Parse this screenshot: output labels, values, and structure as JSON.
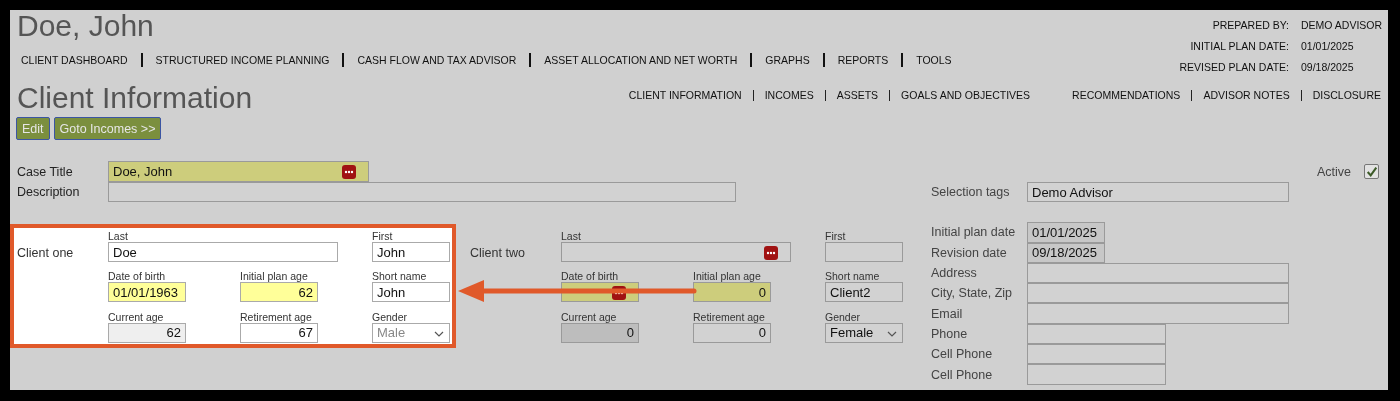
{
  "header": {
    "title": "Doe, John",
    "nav": [
      "CLIENT DASHBOARD",
      "STRUCTURED INCOME PLANNING",
      "CASH FLOW AND TAX ADVISOR",
      "ASSET ALLOCATION AND NET WORTH",
      "GRAPHS",
      "REPORTS",
      "TOOLS"
    ],
    "info": [
      {
        "label": "PREPARED BY:",
        "value": "DEMO ADVISOR"
      },
      {
        "label": "INITIAL PLAN DATE:",
        "value": "01/01/2025"
      },
      {
        "label": "REVISED PLAN DATE:",
        "value": "09/18/2025"
      }
    ]
  },
  "page": {
    "title": "Client Information",
    "subnav_left": [
      "CLIENT INFORMATION",
      "INCOMES",
      "ASSETS",
      "GOALS AND OBJECTIVES"
    ],
    "subnav_right": [
      "RECOMMENDATIONS",
      "ADVISOR NOTES",
      "DISCLOSURE"
    ]
  },
  "buttons": [
    "Edit",
    "Goto Incomes >>"
  ],
  "case_title": {
    "label": "Case Title",
    "value": "Doe, John",
    "required": true,
    "picker": true
  },
  "active": {
    "label": "Active",
    "checked": true
  },
  "description": {
    "label": "Description"
  },
  "selection_tags": {
    "label": "Selection tags",
    "value": "Demo Advisor"
  },
  "clients": [
    {
      "label": "Client one",
      "highlighted": true,
      "fields": [
        {
          "label": "Last",
          "value": "Doe",
          "kind": "text",
          "required": false,
          "readonly": false,
          "picker": false
        },
        {
          "label": "First",
          "value": "John",
          "kind": "text",
          "required": false,
          "readonly": false,
          "picker": false
        },
        {
          "label": "Date of birth",
          "value": "01/01/1963",
          "kind": "text",
          "required": true,
          "readonly": false,
          "picker": false
        },
        {
          "label": "Initial plan age",
          "value": "62",
          "kind": "number",
          "required": true,
          "readonly": false,
          "picker": false
        },
        {
          "label": "Short name",
          "value": "John",
          "kind": "text",
          "required": false,
          "readonly": false,
          "picker": false
        },
        {
          "label": "Current age",
          "value": "62",
          "kind": "number",
          "required": false,
          "readonly": true,
          "picker": false
        },
        {
          "label": "Retirement age",
          "value": "67",
          "kind": "number",
          "required": false,
          "readonly": false,
          "picker": false
        },
        {
          "label": "Gender",
          "value": "Male",
          "kind": "select",
          "required": false,
          "readonly": true,
          "picker": false
        }
      ]
    },
    {
      "label": "Client two",
      "highlighted": false,
      "fields": [
        {
          "label": "Last",
          "kind": "text",
          "required": false,
          "readonly": false,
          "picker": true
        },
        {
          "label": "First",
          "kind": "text",
          "required": false,
          "readonly": false,
          "picker": false
        },
        {
          "label": "Date of birth",
          "kind": "text",
          "required": true,
          "readonly": false,
          "picker": true
        },
        {
          "label": "Initial plan age",
          "value": "0",
          "kind": "number",
          "required": true,
          "readonly": false,
          "picker": false
        },
        {
          "label": "Short name",
          "value": "Client2",
          "kind": "text",
          "required": false,
          "readonly": false,
          "picker": false
        },
        {
          "label": "Current age",
          "value": "0",
          "kind": "number",
          "required": false,
          "readonly": true,
          "picker": false
        },
        {
          "label": "Retirement age",
          "value": "0",
          "kind": "number",
          "required": false,
          "readonly": false,
          "picker": false
        },
        {
          "label": "Gender",
          "value": "Female",
          "kind": "select",
          "required": false,
          "readonly": false,
          "picker": false
        }
      ]
    }
  ],
  "details": [
    {
      "label": "Initial plan date",
      "value": "01/01/2025",
      "kind": "date"
    },
    {
      "label": "Revision date",
      "value": "09/18/2025",
      "kind": "date"
    },
    {
      "label": "Address",
      "kind": "text"
    },
    {
      "label": "City, State, Zip",
      "kind": "text"
    },
    {
      "label": "Email",
      "kind": "text"
    },
    {
      "label": "Phone",
      "kind": "phone"
    },
    {
      "label": "Cell Phone",
      "kind": "phone"
    },
    {
      "label": "Cell Phone",
      "kind": "phone"
    }
  ]
}
